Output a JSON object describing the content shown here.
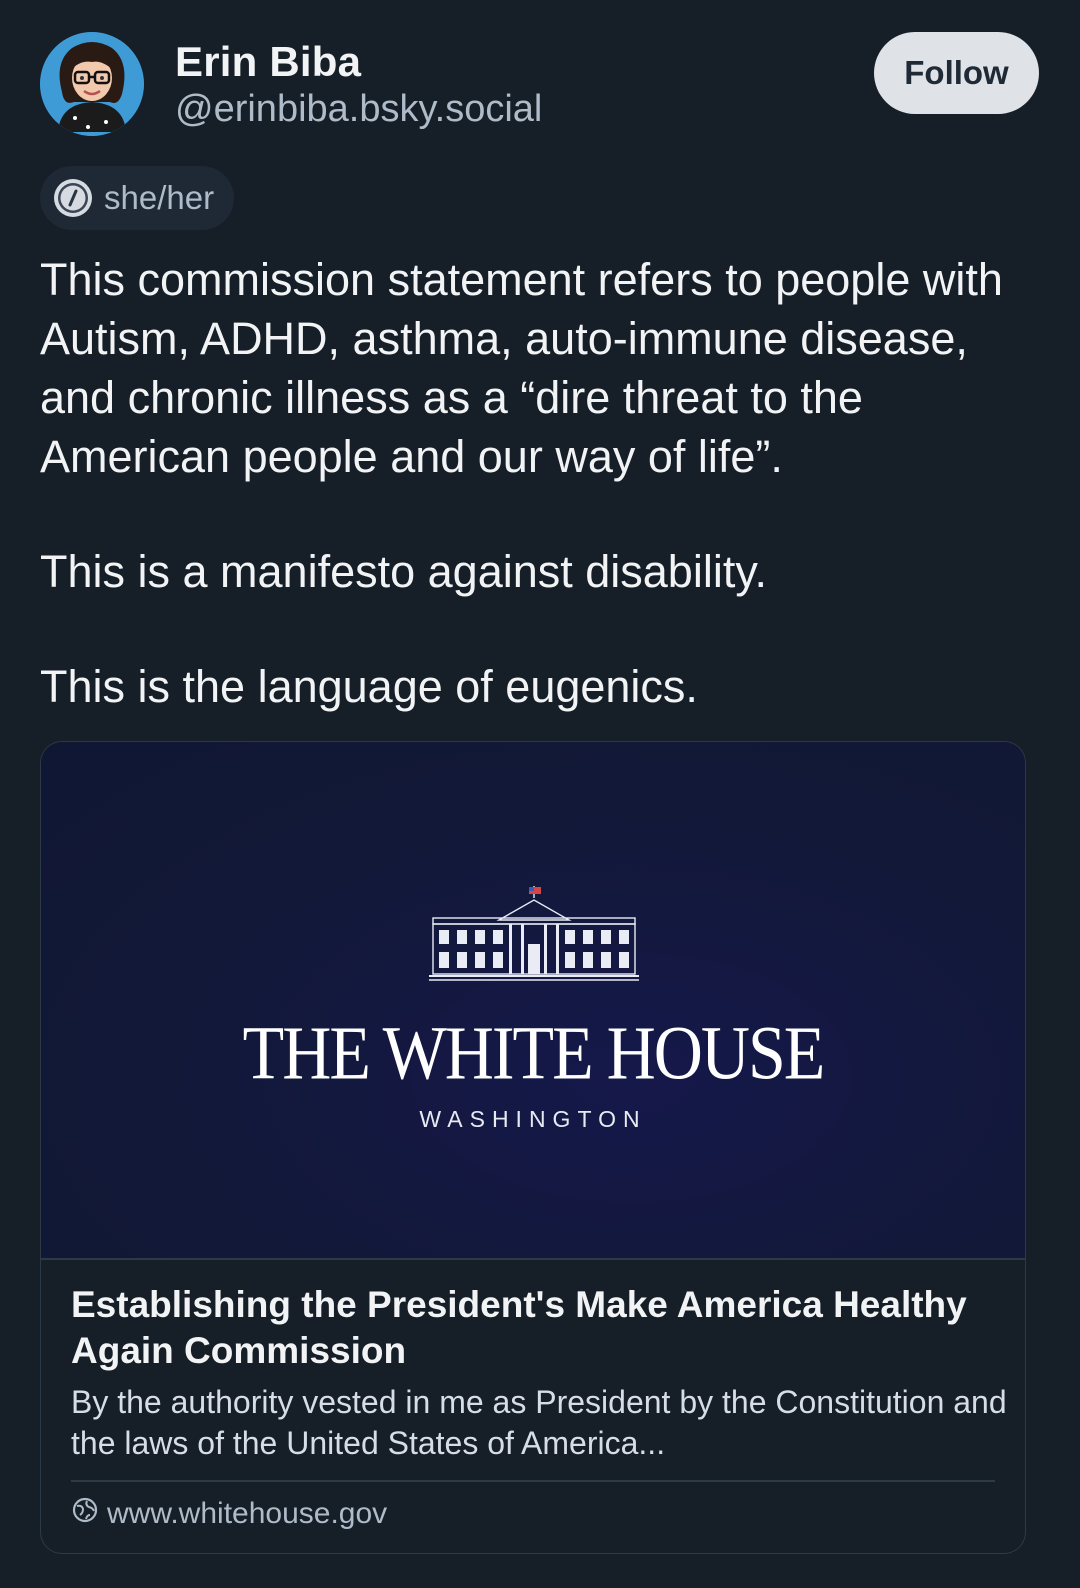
{
  "author": {
    "name": "Erin Biba",
    "handle": "@erinbiba.bsky.social",
    "pronouns": "she/her"
  },
  "follow_label": "Follow",
  "post": {
    "paragraphs": [
      "This commission statement refers to people with Autism, ADHD, asthma, auto-immune disease, and chronic illness as a “dire threat to the American people and our way of life”.",
      "This is a manifesto against disability.",
      "This is the language of eugenics."
    ]
  },
  "link_card": {
    "image_title": "THE WHITE HOUSE",
    "image_subtitle": "WASHINGTON",
    "title": "Establishing the President's Make America Healthy Again Commission",
    "description": "By the authority vested in me as President by the Constitution and the laws of the United States of America...",
    "domain": "www.whitehouse.gov"
  },
  "colors": {
    "background": "#161e27",
    "text_primary": "#f1f3f5",
    "text_secondary": "#aebbc9",
    "follow_button_bg": "#dfe3e8",
    "card_image_bg": "#121838"
  },
  "icons": {
    "pronouns": "info-icon",
    "domain": "globe-icon"
  }
}
